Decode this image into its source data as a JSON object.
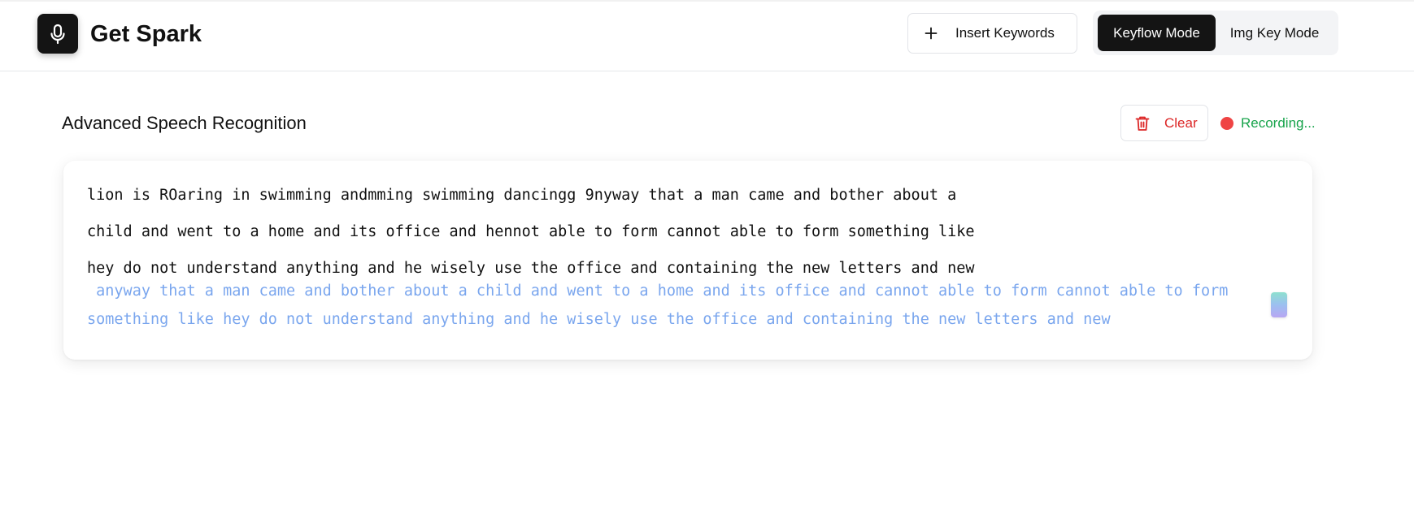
{
  "header": {
    "app_title": "Get Spark",
    "logo_icon": "microphone-icon",
    "insert_keywords_label": "Insert Keywords",
    "modes": {
      "active": "Keyflow Mode",
      "inactive": "Img Key Mode"
    }
  },
  "main": {
    "section_title": "Advanced Speech Recognition",
    "clear_label": "Clear",
    "recording_status": "Recording...",
    "colors": {
      "clear": "#dc2626",
      "recording_dot": "#ef4444",
      "recording_text": "#16a34a",
      "interim_text": "#7aa6ee"
    },
    "transcript": {
      "final_lines": [
        "lion is ROaring in swimming andmming swimming dancingg 9nyway that a man came and bother about a",
        "child and went to a home and its office and hennot able to form cannot able to form something like",
        "hey do not understand anything and he wisely use the office and containing the new letters and new"
      ],
      "interim_lines": [
        " anyway that a man came and bother about a child and went to a home and its office and cannot able to form cannot able to form",
        "something like hey do not understand anything and he wisely use the office and containing the new letters and new"
      ]
    }
  }
}
